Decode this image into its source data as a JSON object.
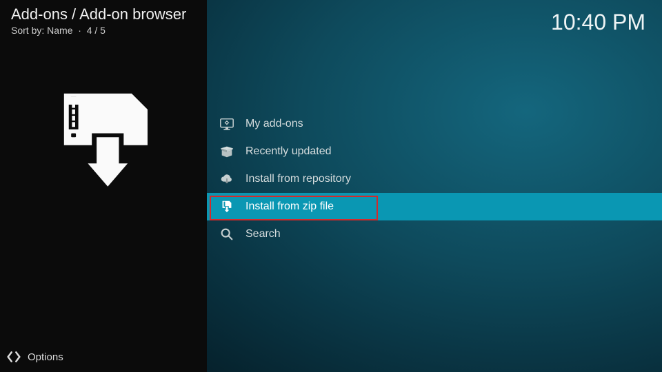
{
  "header": {
    "breadcrumb": "Add-ons / Add-on browser",
    "sort_label": "Sort by: Name",
    "count": "4 / 5",
    "clock": "10:40 PM"
  },
  "menu": {
    "items": [
      {
        "label": "My add-ons"
      },
      {
        "label": "Recently updated"
      },
      {
        "label": "Install from repository"
      },
      {
        "label": "Install from zip file"
      },
      {
        "label": "Search"
      }
    ]
  },
  "footer": {
    "options_label": "Options"
  }
}
